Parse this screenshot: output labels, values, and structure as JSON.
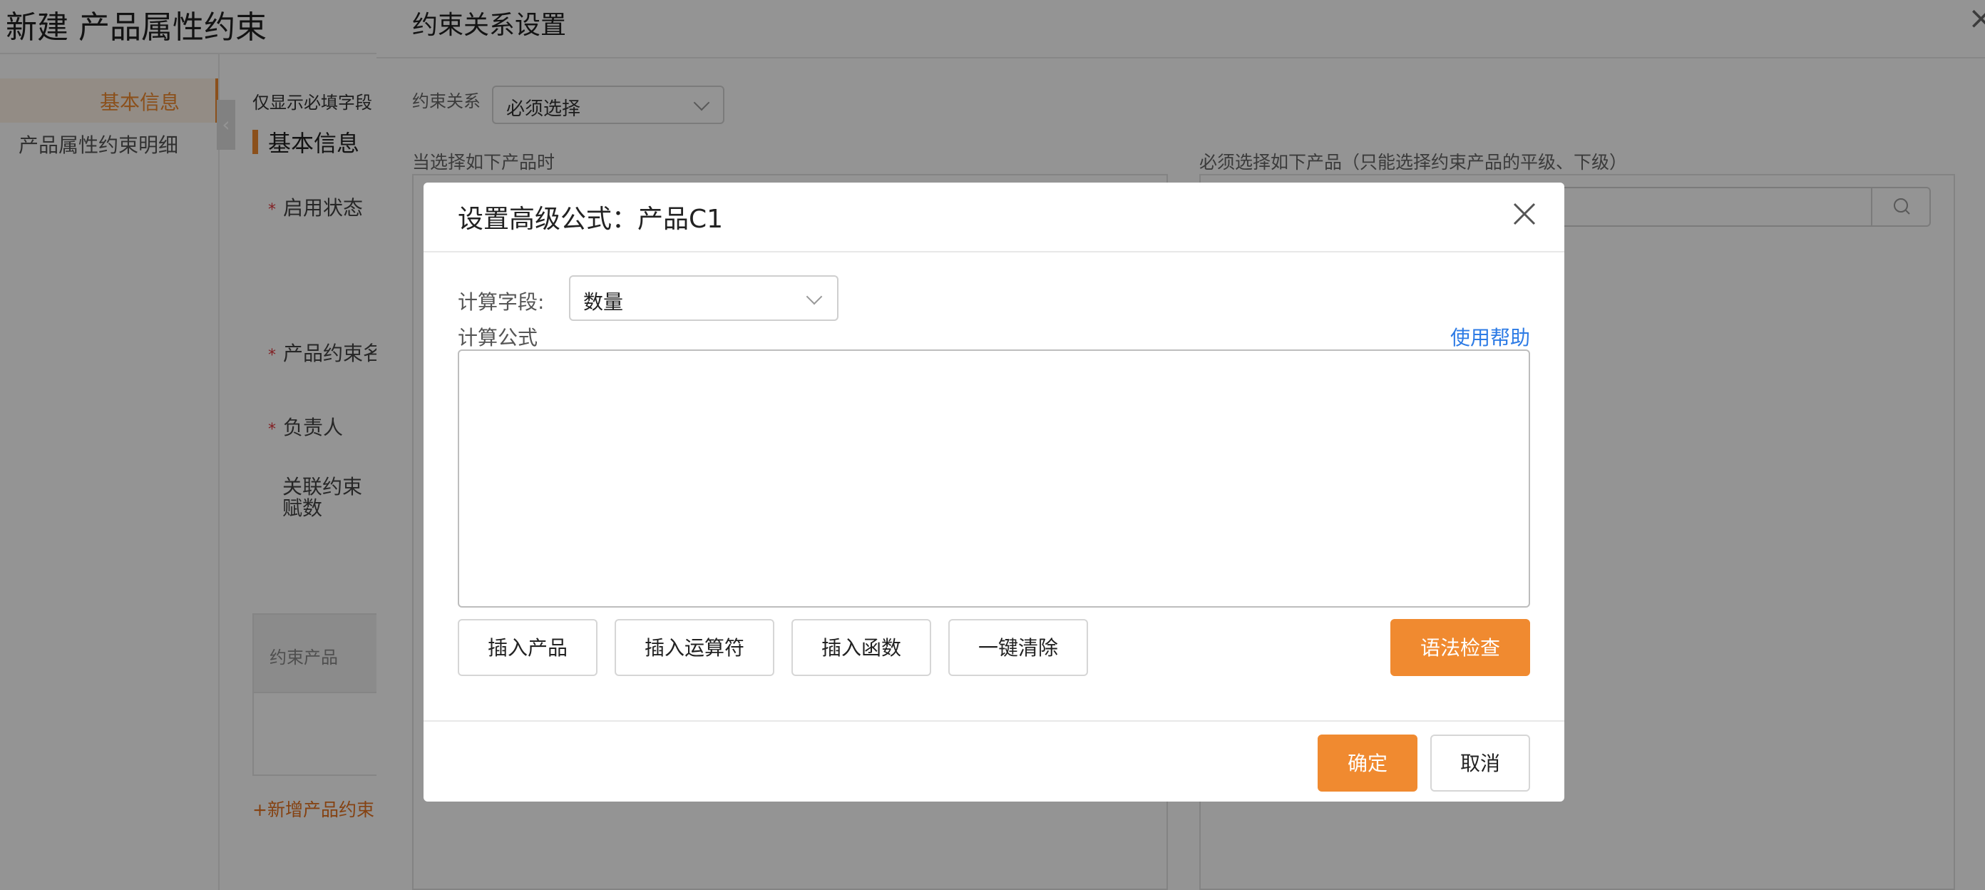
{
  "page": {
    "title": "新建 产品属性约束",
    "nav": [
      "基本信息",
      "产品属性约束明细"
    ],
    "only_required": "仅显示必填字段",
    "section_title": "基本信息",
    "fields": {
      "status": "启用状态",
      "name": "产品约束名",
      "owner": "负责人",
      "linked": "关联约束赋数"
    },
    "table_header": "约束产品",
    "add_constraint": "+新增产品约束"
  },
  "drawer": {
    "title": "约束关系设置",
    "relation_label": "约束关系",
    "relation_value": "必须选择",
    "when_label": "当选择如下产品时",
    "must_label": "必须选择如下产品（只能选择约束产品的平级、下级）"
  },
  "modal": {
    "title": "设置高级公式：产品C1",
    "field_label": "计算字段:",
    "field_value": "数量",
    "formula_label": "计算公式",
    "help_link": "使用帮助",
    "formula_value": "",
    "buttons": {
      "insert_product": "插入产品",
      "insert_operator": "插入运算符",
      "insert_function": "插入函数",
      "clear_all": "一键清除",
      "syntax_check": "语法检查"
    },
    "footer": {
      "confirm": "确定",
      "cancel": "取消"
    }
  },
  "colors": {
    "accent": "#f08a30",
    "link": "#2d7be5",
    "required": "#e0383e"
  }
}
